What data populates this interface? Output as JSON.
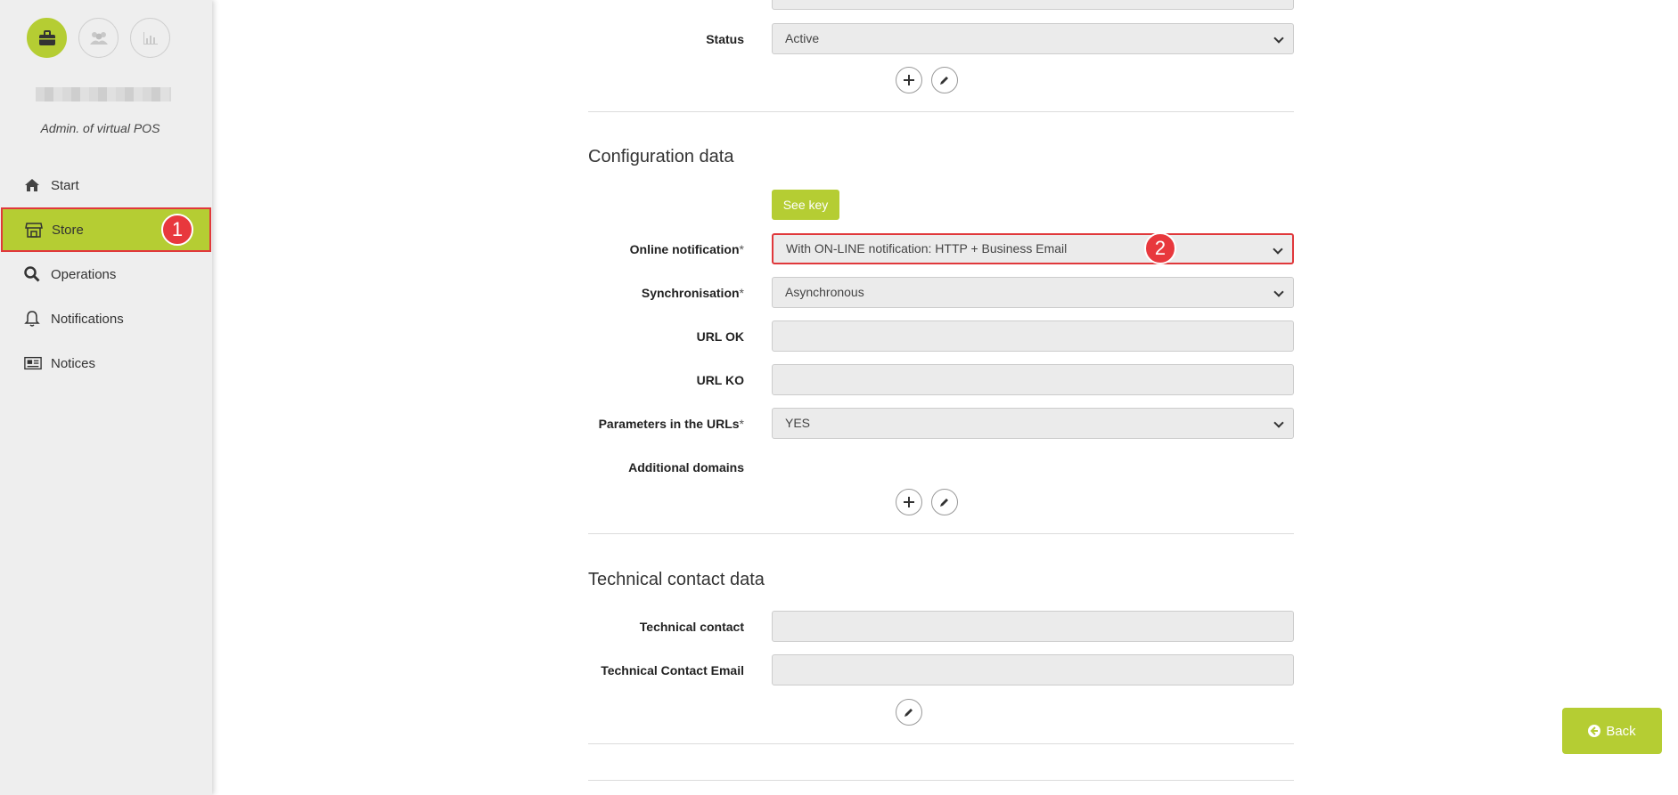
{
  "sidebar": {
    "role": "Admin. of virtual POS",
    "items": [
      {
        "label": "Start"
      },
      {
        "label": "Store"
      },
      {
        "label": "Operations"
      },
      {
        "label": "Notifications"
      },
      {
        "label": "Notices"
      }
    ]
  },
  "badges": {
    "one": "1",
    "two": "2"
  },
  "general": {
    "status_label": "Status",
    "status_value": "Active"
  },
  "config": {
    "title": "Configuration data",
    "see_key": "See key",
    "online_notification_label": "Online notification",
    "online_notification_value": "With ON-LINE notification: HTTP + Business Email",
    "sync_label": "Synchronisation",
    "sync_value": "Asynchronous",
    "url_ok_label": "URL OK",
    "url_ok_value": "",
    "url_ko_label": "URL KO",
    "url_ko_value": "",
    "params_label": "Parameters in the URLs",
    "params_value": "YES",
    "domains_label": "Additional domains",
    "required_mark": "*"
  },
  "technical": {
    "title": "Technical contact data",
    "contact_label": "Technical contact",
    "contact_value": "",
    "email_label": "Technical Contact Email",
    "email_value": ""
  },
  "back_label": "Back",
  "colors": {
    "accent": "#b5cd33",
    "highlight": "#e0383b"
  }
}
